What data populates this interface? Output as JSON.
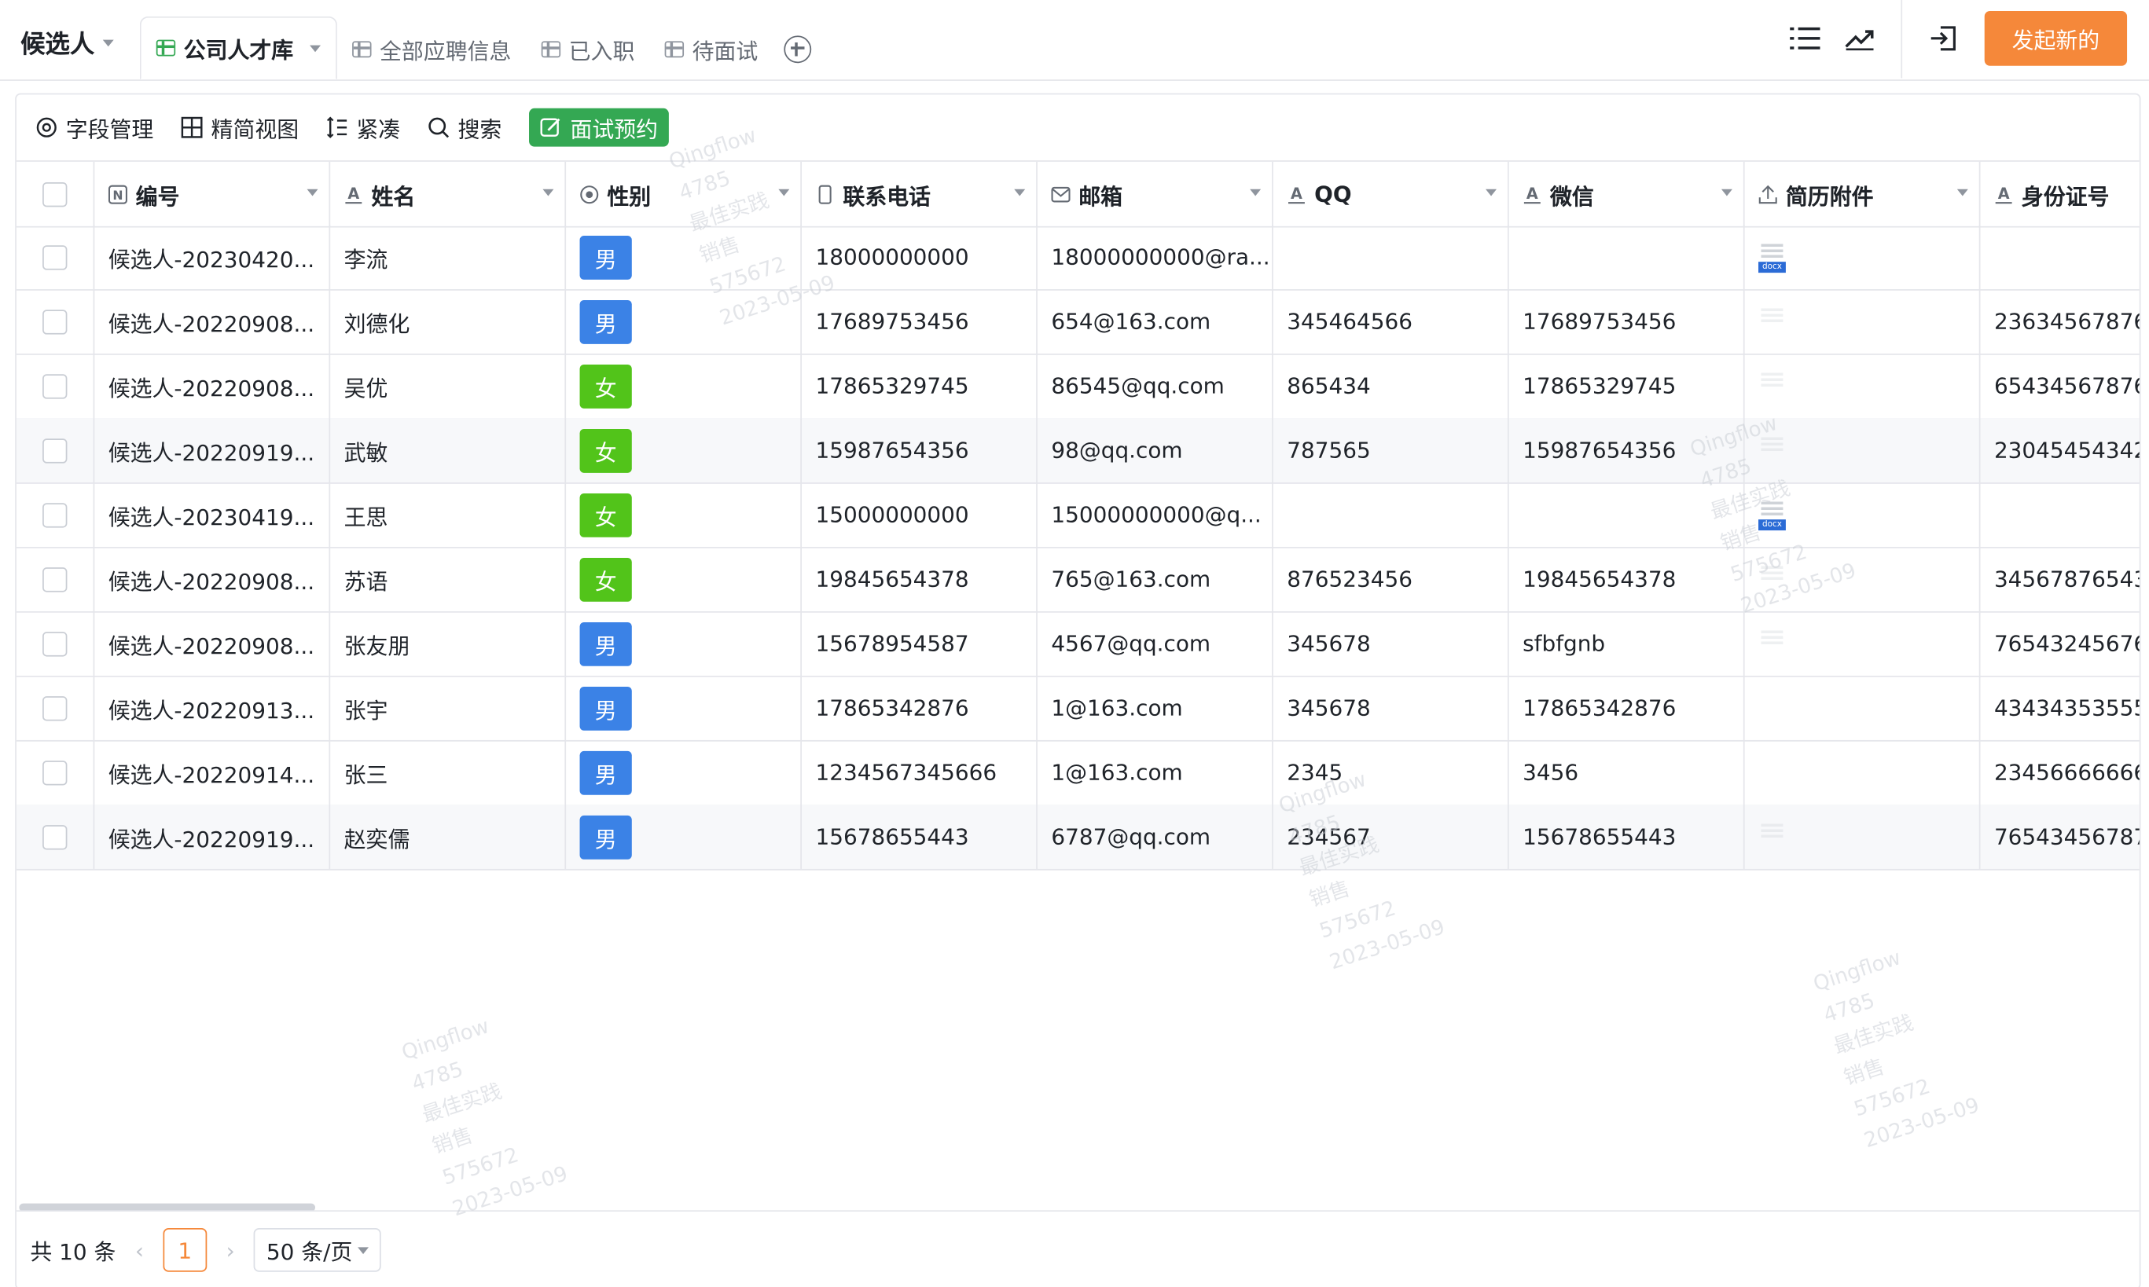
{
  "app": {
    "title": "候选人"
  },
  "tabs": [
    {
      "label": "公司人才库",
      "active": true
    },
    {
      "label": "全部应聘信息"
    },
    {
      "label": "已入职"
    },
    {
      "label": "待面试"
    }
  ],
  "header": {
    "primary_button": "发起新的",
    "icons": [
      "list-icon",
      "trend-icon",
      "exit-icon"
    ]
  },
  "toolbar": {
    "field_manage": "字段管理",
    "compact_view": "精简视图",
    "tight": "紧凑",
    "search": "搜索",
    "interview": "面试预约"
  },
  "columns": [
    "编号",
    "姓名",
    "性别",
    "联系电话",
    "邮箱",
    "QQ",
    "微信",
    "简历附件",
    "身份证号"
  ],
  "rows": [
    {
      "id": "候选人-20230420...",
      "name": "李流",
      "gender": "男",
      "phone": "18000000000",
      "email": "18000000000@ra...",
      "qq": "",
      "wechat": "",
      "resume": "docx",
      "idcard": ""
    },
    {
      "id": "候选人-20220908...",
      "name": "刘德化",
      "gender": "男",
      "phone": "17689753456",
      "email": "654@163.com",
      "qq": "345464566",
      "wechat": "17689753456",
      "resume": "faint",
      "idcard": "23634567876"
    },
    {
      "id": "候选人-20220908...",
      "name": "吴优",
      "gender": "女",
      "phone": "17865329745",
      "email": "86545@qq.com",
      "qq": "865434",
      "wechat": "17865329745",
      "resume": "faint",
      "idcard": "65434567876"
    },
    {
      "id": "候选人-20220919...",
      "name": "武敏",
      "gender": "女",
      "phone": "15987654356",
      "email": "98@qq.com",
      "qq": "787565",
      "wechat": "15987654356",
      "resume": "faint",
      "idcard": "23045454342"
    },
    {
      "id": "候选人-20230419...",
      "name": "王思",
      "gender": "女",
      "phone": "15000000000",
      "email": "15000000000@q...",
      "qq": "",
      "wechat": "",
      "resume": "docx",
      "idcard": ""
    },
    {
      "id": "候选人-20220908...",
      "name": "苏语",
      "gender": "女",
      "phone": "19845654378",
      "email": "765@163.com",
      "qq": "876523456",
      "wechat": "19845654378",
      "resume": "faint",
      "idcard": "34567876543"
    },
    {
      "id": "候选人-20220908...",
      "name": "张友朋",
      "gender": "男",
      "phone": "15678954587",
      "email": "4567@qq.com",
      "qq": "345678",
      "wechat": "sfbfgnb",
      "resume": "faint",
      "idcard": "76543245676"
    },
    {
      "id": "候选人-20220913...",
      "name": "张宇",
      "gender": "男",
      "phone": "17865342876",
      "email": "1@163.com",
      "qq": "345678",
      "wechat": "17865342876",
      "resume": "",
      "idcard": "43434353555"
    },
    {
      "id": "候选人-20220914...",
      "name": "张三",
      "gender": "男",
      "phone": "1234567345666",
      "email": "1@163.com",
      "qq": "2345",
      "wechat": "3456",
      "resume": "",
      "idcard": "23456666666"
    },
    {
      "id": "候选人-20220919...",
      "name": "赵奕儒",
      "gender": "男",
      "phone": "15678655443",
      "email": "6787@qq.com",
      "qq": "234567",
      "wechat": "15678655443",
      "resume": "faint",
      "idcard": "76543456787"
    }
  ],
  "footer": {
    "total": "共 10 条",
    "page": "1",
    "page_size": "50 条/页"
  },
  "watermark": [
    "Qingflow",
    "4785",
    "最佳实践",
    "销售",
    "575672",
    "2023-05-09"
  ],
  "colors": {
    "accent": "#f5883a",
    "green": "#34a853",
    "male": "#3b82e6",
    "female": "#52c41a"
  }
}
